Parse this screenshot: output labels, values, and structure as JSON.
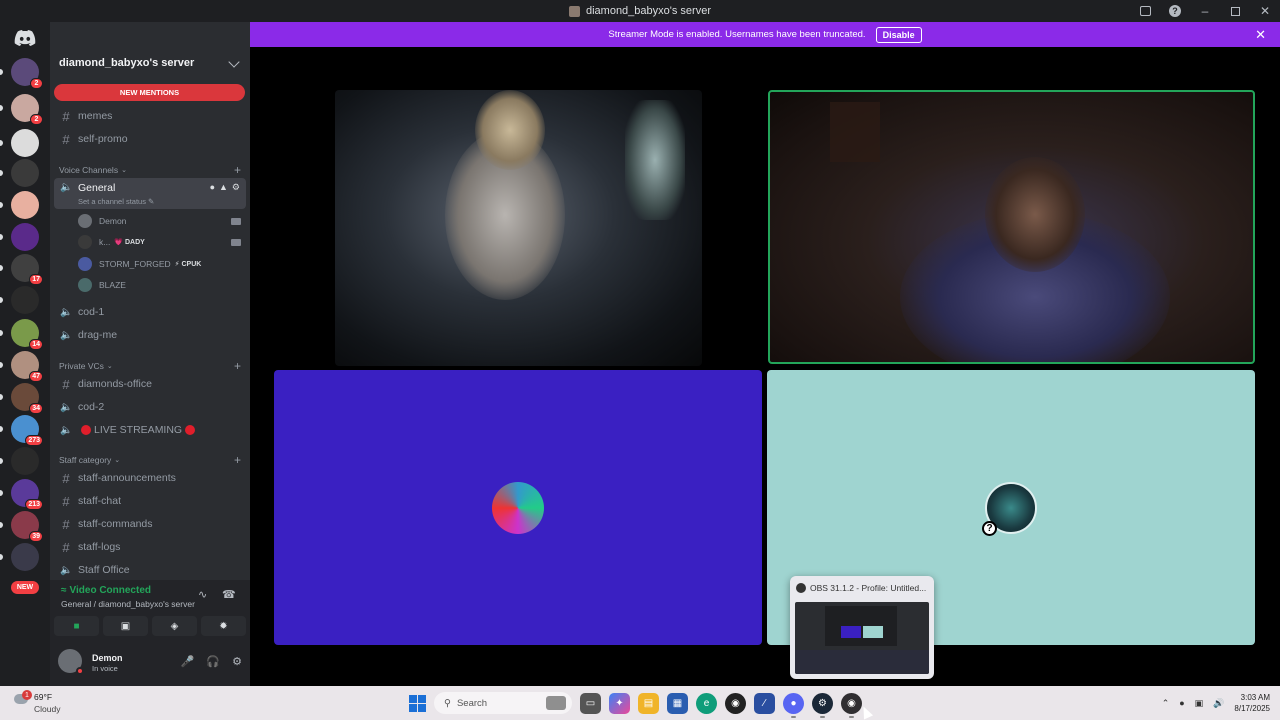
{
  "window": {
    "title": "diamond_babyxo's server"
  },
  "banner": {
    "text": "Streamer Mode is enabled. Usernames have been truncated.",
    "button": "Disable",
    "color": "#8b2ae8"
  },
  "guilds": [
    {
      "badge": "2",
      "color": "#5b4a7a"
    },
    {
      "badge": "2",
      "color": "#c9a8a0"
    },
    {
      "badge": "",
      "color": "#dcdcdc"
    },
    {
      "badge": "",
      "color": "#3a3a3a"
    },
    {
      "badge": "",
      "color": "#e8b0a0"
    },
    {
      "badge": "",
      "color": "#5a2a8a"
    },
    {
      "badge": "17",
      "color": "#404040"
    },
    {
      "badge": "",
      "color": "#2a2a2a"
    },
    {
      "badge": "14",
      "color": "#7a9a4a"
    },
    {
      "badge": "47",
      "color": "#b09080"
    },
    {
      "badge": "34",
      "color": "#6a4a3a"
    },
    {
      "badge": "273",
      "color": "#4a90d0"
    },
    {
      "badge": "",
      "color": "#2a2a2a"
    },
    {
      "badge": "213",
      "color": "#5a3a9a"
    },
    {
      "badge": "39",
      "color": "#8a3a4a"
    },
    {
      "badge": "",
      "color": "#3a3a4a"
    }
  ],
  "new_label": "NEW",
  "server": {
    "name": "diamond_babyxo's server",
    "new_mentions": "NEW MENTIONS",
    "top_channels": [
      "memes",
      "self-promo"
    ],
    "voice_category": "Voice Channels",
    "general": {
      "name": "General",
      "status": "Set a channel status"
    },
    "voice_users": [
      {
        "name": "Demon",
        "tag": "",
        "cam": true,
        "color": "#6a6e74"
      },
      {
        "name": "k...",
        "tag": "💗 DADY",
        "cam": true,
        "color": "#3a3a3a"
      },
      {
        "name": "STORM_FORGED",
        "tag": "⚡ CPUK",
        "cam": false,
        "color": "#4a5aa0"
      },
      {
        "name": "BLAZE",
        "tag": "",
        "cam": false,
        "color": "#4a6a6a"
      }
    ],
    "voice_channels_more": [
      "cod-1",
      "drag-me"
    ],
    "private_category": "Private VCs",
    "private_channels": [
      {
        "type": "text",
        "name": "diamonds-office"
      },
      {
        "type": "voice",
        "name": "cod-2"
      },
      {
        "type": "voice",
        "name": "LIVE STREAMING"
      }
    ],
    "staff_category": "Staff category",
    "staff_channels": [
      {
        "type": "text",
        "name": "staff-announcements"
      },
      {
        "type": "text",
        "name": "staff-chat"
      },
      {
        "type": "text",
        "name": "staff-commands"
      },
      {
        "type": "text",
        "name": "staff-logs"
      },
      {
        "type": "voice",
        "name": "Staff Office"
      }
    ]
  },
  "voice_panel": {
    "title": "Video Connected",
    "subtitle": "General / diamond_babyxo's server"
  },
  "user": {
    "name": "Demon",
    "status": "In voice"
  },
  "tiles": {
    "blue_color": "#3a20c2",
    "mint_color": "#9fd4d0",
    "q_badge": "?"
  },
  "obs_popup": {
    "title": "OBS 31.1.2 - Profile: Untitled..."
  },
  "taskbar": {
    "weather_temp": "69°F",
    "weather_cond": "Cloudy",
    "weather_badge": "1",
    "search": "Search",
    "time": "3:03 AM",
    "date": "8/17/2025"
  }
}
